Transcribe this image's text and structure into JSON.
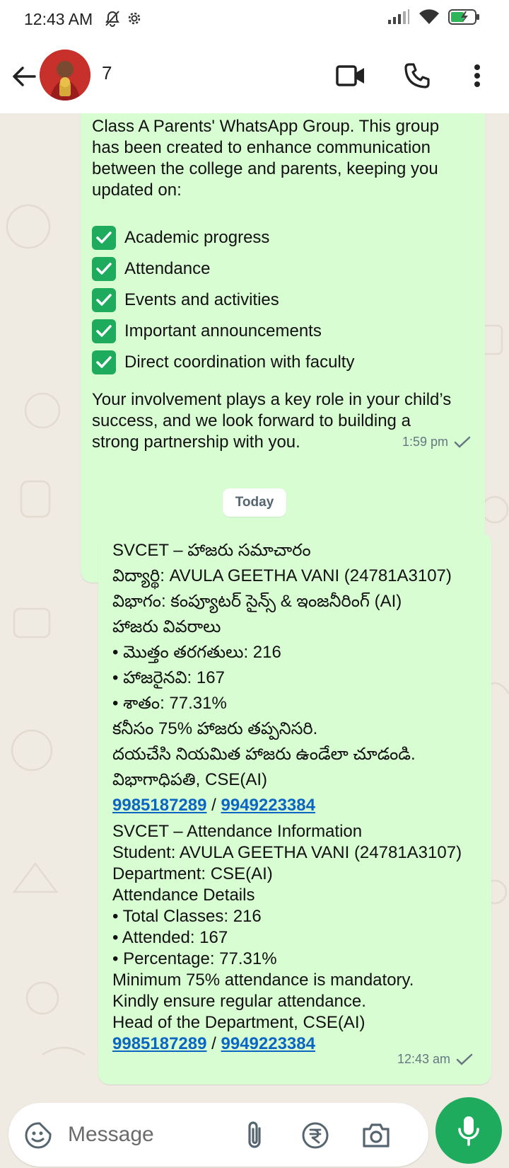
{
  "status_bar": {
    "time": "12:43 AM",
    "left_icons": [
      "mute-icon",
      "gear-icon"
    ],
    "right_icons": [
      "signal-icon",
      "wifi-icon",
      "battery-charging-icon"
    ]
  },
  "header": {
    "contact_name": "7",
    "icons": [
      "back-arrow-icon",
      "video-call-icon",
      "phone-call-icon",
      "more-vert-icon"
    ]
  },
  "messages": [
    {
      "intro_lines": [
        "Class A Parents' WhatsApp Group. This group",
        "has been created to enhance communication",
        "between the college and parents, keeping you",
        "updated on:"
      ],
      "checklist": [
        "Academic progress",
        "Attendance",
        "Events and activities",
        "Important announcements",
        "Direct coordination with faculty"
      ],
      "closing_lines": [
        "Your involvement plays a key role in your child’s",
        "success, and we look forward to building a",
        "strong partnership with you."
      ],
      "time": "1:59 pm",
      "status": "sent"
    },
    {
      "date_chip": "Today",
      "telugu_lines": [
        "SVCET – హాజరు సమాచారం",
        "విద్యార్థి: AVULA GEETHA VANI (24781A3107)",
        "విభాగం: కంప్యూటర్ సైన్స్ & ఇంజనీరింగ్ (AI)",
        "హాజరు వివరాలు",
        "•  మొత్తం తరగతులు: 216",
        "•  హాజరైనవి: 167",
        "•  శాతం: 77.31%",
        "కనీసం 75% హాజరు తప్పనిసరి.",
        "దయచేసి నియమిత హాజరు ఉండేలా చూడండి.",
        "విభాగాధిపతి, CSE(AI)"
      ],
      "phone1": "9985187289",
      "separator": " / ",
      "phone2": "9949223384",
      "english_lines": [
        "SVCET – Attendance Information",
        "Student: AVULA GEETHA VANI (24781A3107)",
        "Department: CSE(AI)",
        "Attendance Details",
        "•  Total Classes: 216",
        "•  Attended: 167",
        "•  Percentage: 77.31%",
        "Minimum 75% attendance is mandatory.",
        "Kindly ensure regular attendance.",
        "Head of the Department, CSE(AI)"
      ],
      "time": "12:43 am",
      "status": "sent"
    }
  ],
  "input": {
    "placeholder": "Message",
    "icons": [
      "sticker-icon",
      "attach-icon",
      "rupee-payment-icon",
      "camera-icon",
      "mic-icon"
    ]
  },
  "colors": {
    "bubble_out": "#d9fdd3",
    "accent_green": "#1fab5e",
    "link_blue": "#0b66c2",
    "wallpaper": "#efeae2"
  }
}
